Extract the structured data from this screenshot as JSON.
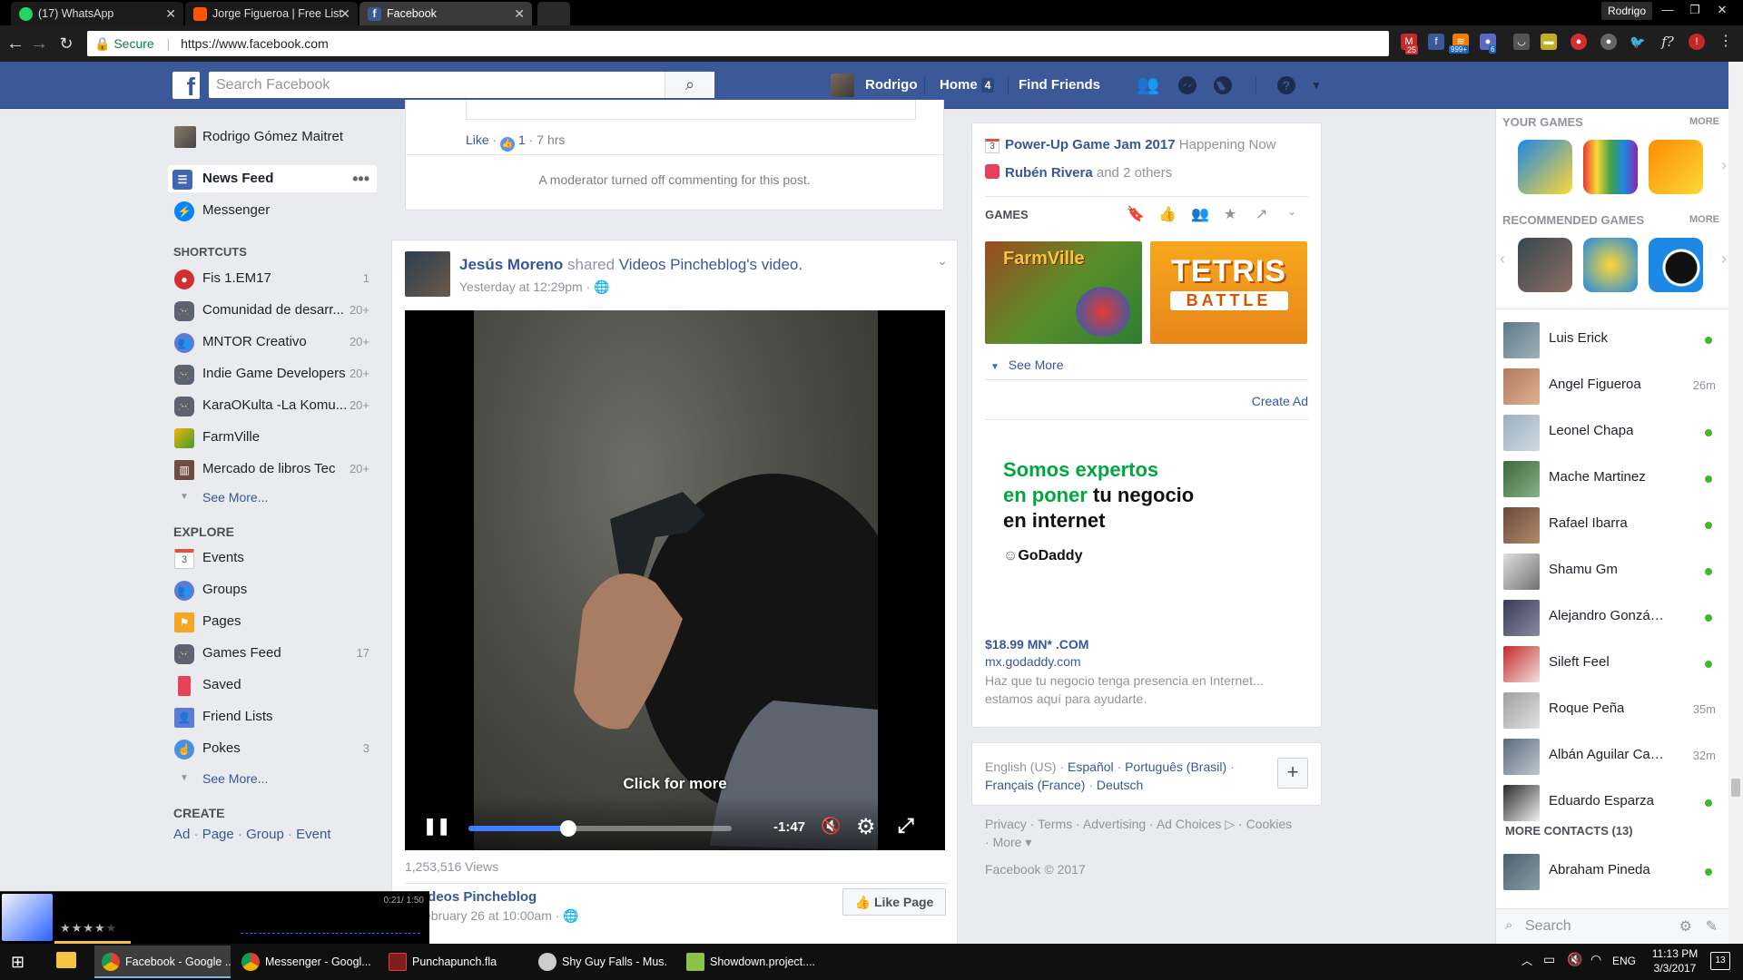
{
  "browser": {
    "tabs": [
      {
        "title": "(17) WhatsApp",
        "icon": "whatsapp-icon"
      },
      {
        "title": "Jorge Figueroa | Free List",
        "icon": "soundcloud-icon"
      },
      {
        "title": "Facebook",
        "icon": "facebook-icon"
      }
    ],
    "profile": "Rodrigo",
    "secure_label": "Secure",
    "url": "https://www.facebook.com",
    "ext_badges": {
      "gmail": "25",
      "feed": "999+",
      "count6": "6"
    }
  },
  "fb_header": {
    "search_placeholder": "Search Facebook",
    "user": "Rodrigo",
    "home": "Home",
    "home_badge": "4",
    "find_friends": "Find Friends"
  },
  "left_nav": {
    "user_name": "Rodrigo Gómez Maitret",
    "news_feed": "News Feed",
    "messenger": "Messenger",
    "shortcuts_title": "SHORTCUTS",
    "shortcuts": [
      {
        "label": "Fis 1.EM17",
        "count": "1"
      },
      {
        "label": "Comunidad de desarr...",
        "count": "20+"
      },
      {
        "label": "MNTOR Creativo",
        "count": "20+"
      },
      {
        "label": "Indie Game Developers",
        "count": "20+"
      },
      {
        "label": "KaraOKulta -La Komu...",
        "count": "20+"
      },
      {
        "label": "FarmVille",
        "count": ""
      },
      {
        "label": "Mercado de libros Tec",
        "count": "20+"
      }
    ],
    "see_more_1": "See More...",
    "explore_title": "EXPLORE",
    "explore": [
      {
        "label": "Events",
        "count": ""
      },
      {
        "label": "Groups",
        "count": ""
      },
      {
        "label": "Pages",
        "count": ""
      },
      {
        "label": "Games Feed",
        "count": "17"
      },
      {
        "label": "Saved",
        "count": ""
      },
      {
        "label": "Friend Lists",
        "count": ""
      },
      {
        "label": "Pokes",
        "count": "3"
      }
    ],
    "see_more_2": "See More...",
    "create_title": "CREATE",
    "create_links": [
      "Ad",
      "Page",
      "Group",
      "Event"
    ],
    "events_icon_day": "3"
  },
  "feed": {
    "prev_post": {
      "like_label": "Like",
      "like_count": "1",
      "time": "7 hrs",
      "moderator_note": "A moderator turned off commenting for this post."
    },
    "post": {
      "author": "Jesús Moreno",
      "shared_text": "shared",
      "page": "Videos Pincheblog",
      "video_suffix": "'s video.",
      "timestamp": "Yesterday at 12:29pm",
      "click_for_more": "Click for more",
      "time_remaining": "-1:47",
      "progress": 0.38,
      "views": "1,253,516 Views",
      "shared_page_name": "ideos Pincheblog",
      "shared_date": "ebruary 26 at 10:00am",
      "like_page": "Like Page"
    }
  },
  "right_col": {
    "events": [
      {
        "title": "Power-Up Game Jam 2017",
        "suffix": "Happening Now",
        "day": "3"
      },
      {
        "title": "Rubén Rivera",
        "suffix": "and 2 others"
      }
    ],
    "games_title": "GAMES",
    "game_tiles": [
      "FarmVille",
      "TETRIS",
      "BATTLE"
    ],
    "see_more": "See More",
    "create_ad": "Create Ad",
    "ad": {
      "headline_green_1": "Somos expertos",
      "headline_green_2": "en poner",
      "headline_black_2": " tu negocio",
      "headline_black_3": "en internet",
      "logo": "GoDaddy",
      "price": "$18.99 MN* .COM",
      "domain": "mx.godaddy.com",
      "desc": "Haz que tu negocio tenga presencia en Internet... estamos aquí para ayudarte."
    },
    "languages": [
      "English (US)",
      "Español",
      "Português (Brasil)",
      "Français (France)",
      "Deutsch"
    ],
    "footer_links": [
      "Privacy",
      "Terms",
      "Advertising",
      "Ad Choices",
      "Cookies",
      "More"
    ],
    "copyright": "Facebook © 2017"
  },
  "right_rail": {
    "your_games_title": "YOUR GAMES",
    "more": "MORE",
    "recommended_title": "RECOMMENDED GAMES",
    "contacts": [
      {
        "name": "Luis Erick",
        "status": "online"
      },
      {
        "name": "Angel Figueroa",
        "status": "26m"
      },
      {
        "name": "Leonel Chapa",
        "status": "online"
      },
      {
        "name": "Mache Martinez",
        "status": "online"
      },
      {
        "name": "Rafael Ibarra",
        "status": "online"
      },
      {
        "name": "Shamu Gm",
        "status": "online"
      },
      {
        "name": "Alejandro González Va...",
        "status": "online"
      },
      {
        "name": "Sileft Feel",
        "status": "online"
      },
      {
        "name": "Roque Peña",
        "status": "35m"
      },
      {
        "name": "Albán Aguilar Campos",
        "status": "32m"
      },
      {
        "name": "Eduardo Esparza",
        "status": "online"
      }
    ],
    "more_contacts": "MORE CONTACTS (13)",
    "more_contacts_list": [
      {
        "name": "Abraham Pineda",
        "status": "online"
      }
    ],
    "search_placeholder": "Search"
  },
  "music_player": {
    "time": "0:21/ 1:50",
    "rating": 4
  },
  "taskbar": {
    "items": [
      {
        "label": "Facebook - Google ...",
        "active": true
      },
      {
        "label": "Messenger - Googl...",
        "active": false
      },
      {
        "label": "Punchapunch.fla",
        "active": false
      },
      {
        "label": "Shy Guy Falls - Mus...",
        "active": false
      },
      {
        "label": "Showdown.project....",
        "active": false
      }
    ],
    "lang": "ENG",
    "time": "11:13 PM",
    "date": "3/3/2017",
    "notif": "13"
  },
  "colors": {
    "fb_blue": "#3b5998",
    "link": "#365899",
    "online": "#42b72a",
    "godaddy_green": "#1bdbdb"
  }
}
